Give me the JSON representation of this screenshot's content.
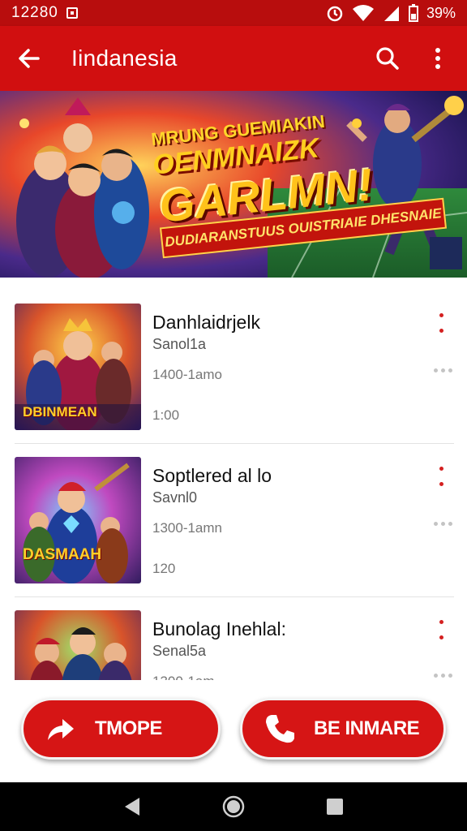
{
  "status_bar": {
    "time": "12280",
    "battery": "39%",
    "icons": [
      "sim-card-icon",
      "alarm-icon",
      "wifi-icon",
      "signal-icon",
      "battery-icon"
    ]
  },
  "app_bar": {
    "title": "Iindanesia",
    "icons": [
      "back-arrow-icon",
      "search-icon",
      "overflow-menu-icon"
    ]
  },
  "banner": {
    "line1": "MRUNG GUEMIAKIN",
    "line2": "OENMNAIZK",
    "line3": "GARLMN!",
    "ribbon": "DUDIARANSTUUS OUISTRIAIE DHESNAIE"
  },
  "list": {
    "items": [
      {
        "name": "Danhlaidrjelk",
        "subtitle": "Sanol1a",
        "duration": "1400-1amo",
        "count": "1:00",
        "thumb_caption": "DBINMEAN"
      },
      {
        "name": "Soptlered al lo",
        "subtitle": "Savnl0",
        "duration": "1300-1amn",
        "count": "120",
        "thumb_caption": "DASMAAH"
      },
      {
        "name": "Bunolag Inehlal:",
        "subtitle": "Senal5a",
        "duration": "1300-1am",
        "count": "",
        "thumb_caption": ""
      }
    ]
  },
  "actions": {
    "share_label": "TMOPE",
    "call_label": "BE INMARE"
  },
  "colors": {
    "primary": "#d10f10",
    "status_bar": "#b80d0d",
    "button": "#d61515",
    "navbar": "#000000"
  }
}
